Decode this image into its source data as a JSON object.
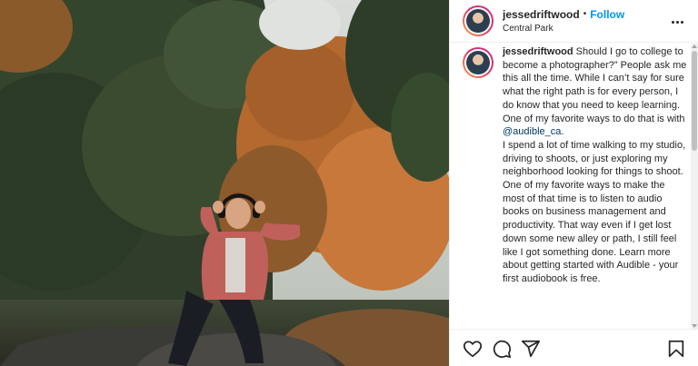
{
  "post": {
    "username": "jessedriftwood",
    "separator": "•",
    "follow_label": "Follow",
    "location": "Central Park",
    "caption_username": "jessedriftwood",
    "caption_part1": " Should I go to college to become a photographer?” People ask me this all the time. While I can’t say for sure what the right path is for every person, I do know that you need to keep learning. One of my favorite ways to do that is with ",
    "caption_mention": "@audible_ca",
    "caption_part2": ".",
    "caption_part3": "I spend a lot of time walking to my studio, driving to shoots, or just exploring my neighborhood looking for things to shoot. One of my favorite ways to make the most of that time is to listen to audio books on business management and productivity. That way even if I get lost down some new alley or path, I still feel like I got something done. Learn more about getting started with Audible - your first audiobook is free."
  },
  "icons": {
    "more": "more-options-icon",
    "like": "heart-icon",
    "comment": "comment-icon",
    "share": "paper-plane-icon",
    "save": "bookmark-icon"
  },
  "colors": {
    "follow": "#0095f6",
    "mention": "#00376b",
    "text": "#262626"
  }
}
